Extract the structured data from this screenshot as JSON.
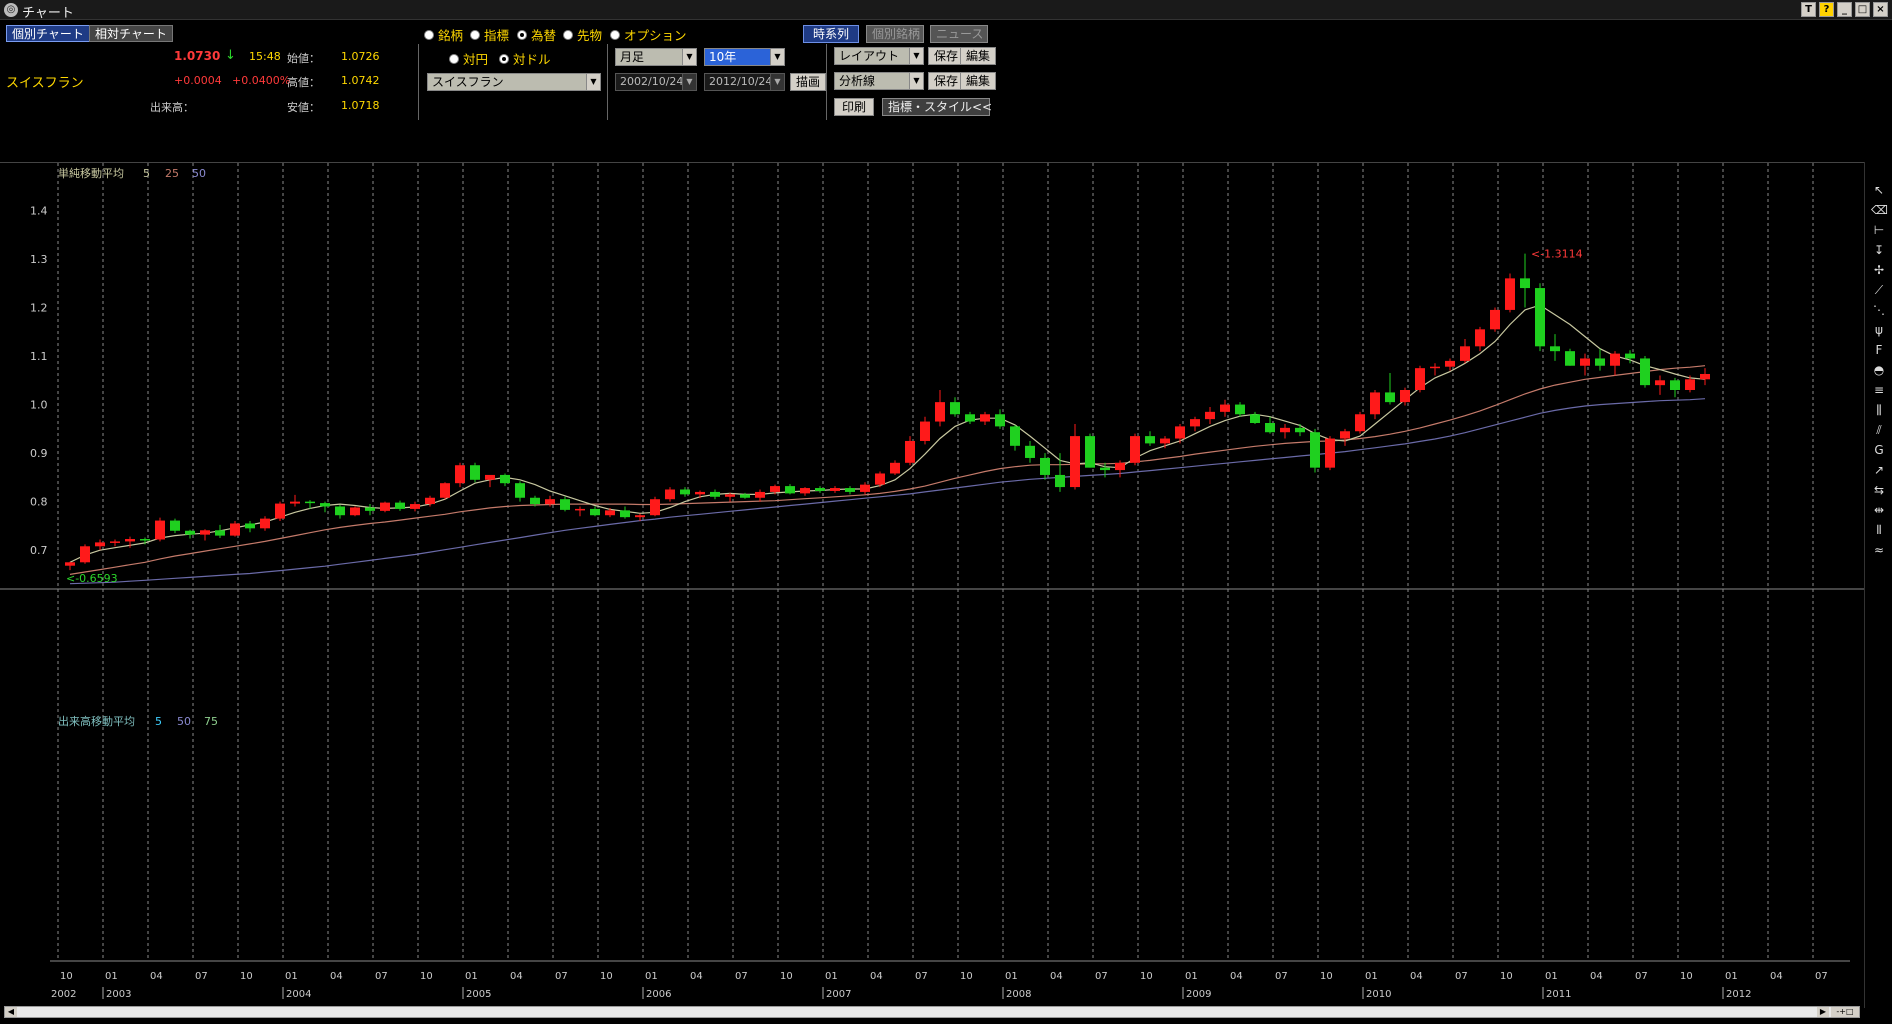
{
  "window": {
    "title": "チャート",
    "buttons": [
      "T",
      "?",
      "_",
      "□",
      "×"
    ]
  },
  "tabs": [
    {
      "label": "個別チャート",
      "active": true
    },
    {
      "label": "相対チャート",
      "active": false
    }
  ],
  "quote": {
    "name": "スイスフラン",
    "price": "1.0730",
    "arrow": "↓",
    "time": "15:48",
    "change": "+0.0004",
    "change_pct": "+0.0400%",
    "volume_label": "出来高：",
    "open_label": "始値：",
    "open": "1.0726",
    "high_label": "高値：",
    "high": "1.0742",
    "low_label": "安値：",
    "low": "1.0718"
  },
  "instrument_type": {
    "options": [
      "銘柄",
      "指標",
      "為替",
      "先物",
      "オプション"
    ],
    "selected": "為替"
  },
  "base_currency": {
    "options": [
      "対円",
      "対ドル"
    ],
    "selected": "対ドル"
  },
  "currency_select": "スイスフラン",
  "period": {
    "interval": "月足",
    "range": "10年",
    "from": "2002/10/24",
    "to": "2012/10/24",
    "draw_button": "描画"
  },
  "view_buttons": {
    "timeseries": "時系列",
    "individual": "個別銘柄",
    "news": "ニュース"
  },
  "layout": {
    "layout_select": "レイアウト",
    "analysis_select": "分析線",
    "save": "保存",
    "edit": "編集",
    "print": "印刷",
    "style_button": "指標・スタイル<<"
  },
  "colors": {
    "up_candle": "#ff1a1a",
    "down_candle": "#1fd01f",
    "ma5": "#c8c8a0",
    "ma25": "#c47a6a",
    "ma50": "#6a6aa8",
    "grid": "#8a8a8a",
    "label_yellow": "#ffd800"
  },
  "toolbar_icons": [
    "cursor-icon",
    "eraser-icon",
    "horizontal-line-icon",
    "vertical-line-icon",
    "cross-line-icon",
    "trend-line-icon",
    "fan-icon",
    "pitchfork-icon",
    "fibonacci-fan-icon",
    "fibonacci-arc-icon",
    "fibonacci-retracement-icon",
    "fibonacci-time-icon",
    "channel-icon",
    "gann-icon",
    "regression-icon",
    "period-icon",
    "cycle-icon",
    "wave-icon",
    "gann-fan-icon"
  ],
  "chart_data": {
    "type": "candlestick",
    "price_panel": {
      "indicator_label": "単純移動平均",
      "ma_periods": [
        "5",
        "25",
        "50"
      ],
      "yticks": [
        "0.7",
        "0.8",
        "0.9",
        "1.0",
        "1.1",
        "1.2",
        "1.3",
        "1.4"
      ],
      "ylim": [
        0.62,
        1.44
      ],
      "low_annotation": "<-0.6593",
      "high_annotation": "<-1.3114"
    },
    "volume_panel": {
      "indicator_label": "出来高移動平均",
      "ma_periods": [
        "5",
        "50",
        "75"
      ]
    },
    "months": [
      "10",
      "01",
      "04",
      "07",
      "10",
      "01",
      "04",
      "07",
      "10",
      "01",
      "04",
      "07",
      "10",
      "01",
      "04",
      "07",
      "10",
      "01",
      "04",
      "07",
      "10",
      "01",
      "04",
      "07",
      "10",
      "01",
      "04",
      "07",
      "10",
      "01",
      "04",
      "07",
      "10",
      "01",
      "04",
      "07",
      "10",
      "01",
      "04",
      "07"
    ],
    "years": [
      "2002",
      "2003",
      "2004",
      "2005",
      "2006",
      "2007",
      "2008",
      "2009",
      "2010",
      "2011",
      "2012"
    ],
    "candles": [
      [
        0.668,
        0.676,
        0.659,
        0.675
      ],
      [
        0.675,
        0.712,
        0.672,
        0.708
      ],
      [
        0.708,
        0.722,
        0.7,
        0.716
      ],
      [
        0.716,
        0.722,
        0.708,
        0.718
      ],
      [
        0.718,
        0.728,
        0.705,
        0.723
      ],
      [
        0.723,
        0.726,
        0.712,
        0.722
      ],
      [
        0.722,
        0.767,
        0.718,
        0.761
      ],
      [
        0.761,
        0.765,
        0.735,
        0.74
      ],
      [
        0.74,
        0.742,
        0.724,
        0.732
      ],
      [
        0.732,
        0.743,
        0.72,
        0.741
      ],
      [
        0.741,
        0.752,
        0.725,
        0.73
      ],
      [
        0.73,
        0.76,
        0.728,
        0.755
      ],
      [
        0.755,
        0.76,
        0.737,
        0.745
      ],
      [
        0.745,
        0.77,
        0.74,
        0.765
      ],
      [
        0.765,
        0.8,
        0.76,
        0.796
      ],
      [
        0.796,
        0.814,
        0.79,
        0.8
      ],
      [
        0.8,
        0.803,
        0.785,
        0.797
      ],
      [
        0.797,
        0.8,
        0.778,
        0.79
      ],
      [
        0.79,
        0.793,
        0.765,
        0.772
      ],
      [
        0.772,
        0.79,
        0.77,
        0.788
      ],
      [
        0.788,
        0.795,
        0.772,
        0.781
      ],
      [
        0.781,
        0.8,
        0.778,
        0.798
      ],
      [
        0.798,
        0.802,
        0.781,
        0.785
      ],
      [
        0.785,
        0.8,
        0.78,
        0.795
      ],
      [
        0.795,
        0.812,
        0.79,
        0.808
      ],
      [
        0.808,
        0.84,
        0.805,
        0.838
      ],
      [
        0.838,
        0.88,
        0.83,
        0.875
      ],
      [
        0.875,
        0.88,
        0.84,
        0.845
      ],
      [
        0.845,
        0.855,
        0.83,
        0.855
      ],
      [
        0.855,
        0.858,
        0.832,
        0.838
      ],
      [
        0.838,
        0.842,
        0.8,
        0.808
      ],
      [
        0.808,
        0.812,
        0.79,
        0.795
      ],
      [
        0.795,
        0.812,
        0.79,
        0.805
      ],
      [
        0.805,
        0.81,
        0.78,
        0.783
      ],
      [
        0.783,
        0.79,
        0.77,
        0.785
      ],
      [
        0.785,
        0.79,
        0.77,
        0.772
      ],
      [
        0.772,
        0.787,
        0.768,
        0.782
      ],
      [
        0.782,
        0.79,
        0.765,
        0.768
      ],
      [
        0.768,
        0.775,
        0.76,
        0.772
      ],
      [
        0.772,
        0.81,
        0.77,
        0.805
      ],
      [
        0.805,
        0.83,
        0.8,
        0.825
      ],
      [
        0.825,
        0.83,
        0.81,
        0.815
      ],
      [
        0.815,
        0.823,
        0.807,
        0.82
      ],
      [
        0.82,
        0.825,
        0.805,
        0.81
      ],
      [
        0.81,
        0.818,
        0.8,
        0.815
      ],
      [
        0.815,
        0.818,
        0.806,
        0.808
      ],
      [
        0.808,
        0.825,
        0.8,
        0.82
      ],
      [
        0.82,
        0.835,
        0.815,
        0.832
      ],
      [
        0.832,
        0.836,
        0.815,
        0.817
      ],
      [
        0.817,
        0.83,
        0.812,
        0.828
      ],
      [
        0.828,
        0.832,
        0.818,
        0.822
      ],
      [
        0.822,
        0.832,
        0.818,
        0.828
      ],
      [
        0.828,
        0.832,
        0.815,
        0.82
      ],
      [
        0.82,
        0.84,
        0.815,
        0.835
      ],
      [
        0.835,
        0.862,
        0.83,
        0.858
      ],
      [
        0.858,
        0.885,
        0.855,
        0.88
      ],
      [
        0.88,
        0.935,
        0.875,
        0.925
      ],
      [
        0.925,
        0.975,
        0.918,
        0.965
      ],
      [
        0.965,
        1.03,
        0.955,
        1.005
      ],
      [
        1.005,
        1.015,
        0.975,
        0.98
      ],
      [
        0.98,
        0.985,
        0.96,
        0.965
      ],
      [
        0.965,
        0.985,
        0.958,
        0.98
      ],
      [
        0.98,
        0.99,
        0.95,
        0.955
      ],
      [
        0.955,
        0.958,
        0.905,
        0.915
      ],
      [
        0.915,
        0.925,
        0.88,
        0.89
      ],
      [
        0.89,
        0.9,
        0.845,
        0.855
      ],
      [
        0.855,
        0.9,
        0.82,
        0.83
      ],
      [
        0.83,
        0.96,
        0.825,
        0.935
      ],
      [
        0.935,
        0.94,
        0.87,
        0.87
      ],
      [
        0.87,
        0.88,
        0.85,
        0.865
      ],
      [
        0.865,
        0.885,
        0.85,
        0.88
      ],
      [
        0.88,
        0.94,
        0.875,
        0.935
      ],
      [
        0.935,
        0.945,
        0.915,
        0.92
      ],
      [
        0.92,
        0.935,
        0.91,
        0.93
      ],
      [
        0.93,
        0.96,
        0.92,
        0.955
      ],
      [
        0.955,
        0.975,
        0.945,
        0.97
      ],
      [
        0.97,
        0.995,
        0.96,
        0.985
      ],
      [
        0.985,
        1.01,
        0.975,
        1.0
      ],
      [
        1.0,
        1.005,
        0.975,
        0.98
      ],
      [
        0.98,
        0.985,
        0.96,
        0.962
      ],
      [
        0.962,
        0.975,
        0.94,
        0.943
      ],
      [
        0.943,
        0.96,
        0.93,
        0.952
      ],
      [
        0.952,
        0.96,
        0.935,
        0.943
      ],
      [
        0.943,
        0.95,
        0.86,
        0.87
      ],
      [
        0.87,
        0.935,
        0.865,
        0.93
      ],
      [
        0.93,
        0.95,
        0.915,
        0.945
      ],
      [
        0.945,
        0.985,
        0.94,
        0.98
      ],
      [
        0.98,
        1.03,
        0.97,
        1.025
      ],
      [
        1.025,
        1.065,
        1.0,
        1.005
      ],
      [
        1.005,
        1.035,
        0.998,
        1.03
      ],
      [
        1.03,
        1.08,
        1.025,
        1.075
      ],
      [
        1.075,
        1.085,
        1.06,
        1.078
      ],
      [
        1.078,
        1.095,
        1.07,
        1.09
      ],
      [
        1.09,
        1.135,
        1.085,
        1.12
      ],
      [
        1.12,
        1.16,
        1.11,
        1.155
      ],
      [
        1.155,
        1.2,
        1.15,
        1.195
      ],
      [
        1.195,
        1.27,
        1.19,
        1.26
      ],
      [
        1.26,
        1.311,
        1.2,
        1.24
      ],
      [
        1.24,
        1.25,
        1.11,
        1.12
      ],
      [
        1.12,
        1.145,
        1.09,
        1.11
      ],
      [
        1.11,
        1.115,
        1.08,
        1.08
      ],
      [
        1.08,
        1.105,
        1.06,
        1.095
      ],
      [
        1.095,
        1.115,
        1.07,
        1.08
      ],
      [
        1.08,
        1.11,
        1.06,
        1.105
      ],
      [
        1.105,
        1.112,
        1.085,
        1.095
      ],
      [
        1.095,
        1.1,
        1.035,
        1.04
      ],
      [
        1.04,
        1.06,
        1.02,
        1.05
      ],
      [
        1.05,
        1.055,
        1.015,
        1.03
      ],
      [
        1.03,
        1.06,
        1.025,
        1.052
      ],
      [
        1.052,
        1.075,
        1.04,
        1.063
      ]
    ],
    "ma5": [
      0.675,
      0.69,
      0.7,
      0.705,
      0.71,
      0.715,
      0.725,
      0.73,
      0.733,
      0.735,
      0.74,
      0.746,
      0.752,
      0.758,
      0.768,
      0.778,
      0.786,
      0.792,
      0.795,
      0.792,
      0.788,
      0.786,
      0.787,
      0.789,
      0.795,
      0.805,
      0.822,
      0.838,
      0.845,
      0.85,
      0.845,
      0.835,
      0.822,
      0.812,
      0.802,
      0.792,
      0.784,
      0.78,
      0.776,
      0.778,
      0.788,
      0.8,
      0.81,
      0.815,
      0.817,
      0.815,
      0.815,
      0.818,
      0.82,
      0.822,
      0.823,
      0.825,
      0.826,
      0.826,
      0.833,
      0.845,
      0.868,
      0.898,
      0.93,
      0.955,
      0.968,
      0.972,
      0.972,
      0.958,
      0.935,
      0.91,
      0.885,
      0.878,
      0.88,
      0.872,
      0.87,
      0.89,
      0.905,
      0.915,
      0.925,
      0.94,
      0.955,
      0.967,
      0.976,
      0.98,
      0.975,
      0.966,
      0.957,
      0.94,
      0.928,
      0.925,
      0.935,
      0.96,
      0.985,
      1.01,
      1.035,
      1.055,
      1.068,
      1.085,
      1.105,
      1.13,
      1.165,
      1.195,
      1.205,
      1.185,
      1.165,
      1.14,
      1.115,
      1.1,
      1.092,
      1.08,
      1.072,
      1.063,
      1.055,
      1.052
    ],
    "ma25": [
      0.65,
      0.655,
      0.66,
      0.665,
      0.67,
      0.675,
      0.682,
      0.688,
      0.693,
      0.698,
      0.703,
      0.708,
      0.713,
      0.718,
      0.724,
      0.73,
      0.736,
      0.742,
      0.747,
      0.751,
      0.755,
      0.758,
      0.762,
      0.766,
      0.77,
      0.774,
      0.779,
      0.783,
      0.787,
      0.79,
      0.792,
      0.793,
      0.794,
      0.795,
      0.795,
      0.795,
      0.795,
      0.795,
      0.794,
      0.794,
      0.795,
      0.796,
      0.797,
      0.798,
      0.799,
      0.8,
      0.801,
      0.802,
      0.804,
      0.806,
      0.808,
      0.81,
      0.812,
      0.814,
      0.817,
      0.821,
      0.826,
      0.832,
      0.84,
      0.848,
      0.855,
      0.862,
      0.868,
      0.872,
      0.875,
      0.876,
      0.876,
      0.877,
      0.878,
      0.878,
      0.879,
      0.882,
      0.885,
      0.889,
      0.893,
      0.898,
      0.902,
      0.906,
      0.91,
      0.914,
      0.917,
      0.92,
      0.922,
      0.924,
      0.925,
      0.927,
      0.93,
      0.934,
      0.939,
      0.945,
      0.952,
      0.96,
      0.968,
      0.977,
      0.987,
      0.998,
      1.01,
      1.022,
      1.032,
      1.04,
      1.046,
      1.052,
      1.056,
      1.06,
      1.064,
      1.068,
      1.072,
      1.075,
      1.077,
      1.08
    ],
    "ma50": [
      0.631,
      0.632,
      0.633,
      0.634,
      0.636,
      0.638,
      0.64,
      0.642,
      0.644,
      0.646,
      0.648,
      0.65,
      0.652,
      0.655,
      0.658,
      0.661,
      0.664,
      0.667,
      0.671,
      0.675,
      0.679,
      0.683,
      0.687,
      0.691,
      0.696,
      0.701,
      0.706,
      0.711,
      0.716,
      0.721,
      0.726,
      0.731,
      0.736,
      0.741,
      0.745,
      0.749,
      0.753,
      0.757,
      0.761,
      0.764,
      0.768,
      0.771,
      0.774,
      0.777,
      0.78,
      0.783,
      0.786,
      0.789,
      0.792,
      0.795,
      0.798,
      0.801,
      0.804,
      0.807,
      0.81,
      0.813,
      0.816,
      0.82,
      0.824,
      0.828,
      0.832,
      0.836,
      0.84,
      0.843,
      0.846,
      0.848,
      0.85,
      0.852,
      0.854,
      0.856,
      0.858,
      0.861,
      0.864,
      0.867,
      0.87,
      0.873,
      0.876,
      0.879,
      0.882,
      0.885,
      0.888,
      0.891,
      0.894,
      0.897,
      0.9,
      0.903,
      0.907,
      0.911,
      0.915,
      0.919,
      0.924,
      0.929,
      0.935,
      0.942,
      0.95,
      0.958,
      0.966,
      0.974,
      0.982,
      0.988,
      0.993,
      0.997,
      1.0,
      1.002,
      1.004,
      1.006,
      1.008,
      1.009,
      1.01,
      1.012
    ]
  }
}
